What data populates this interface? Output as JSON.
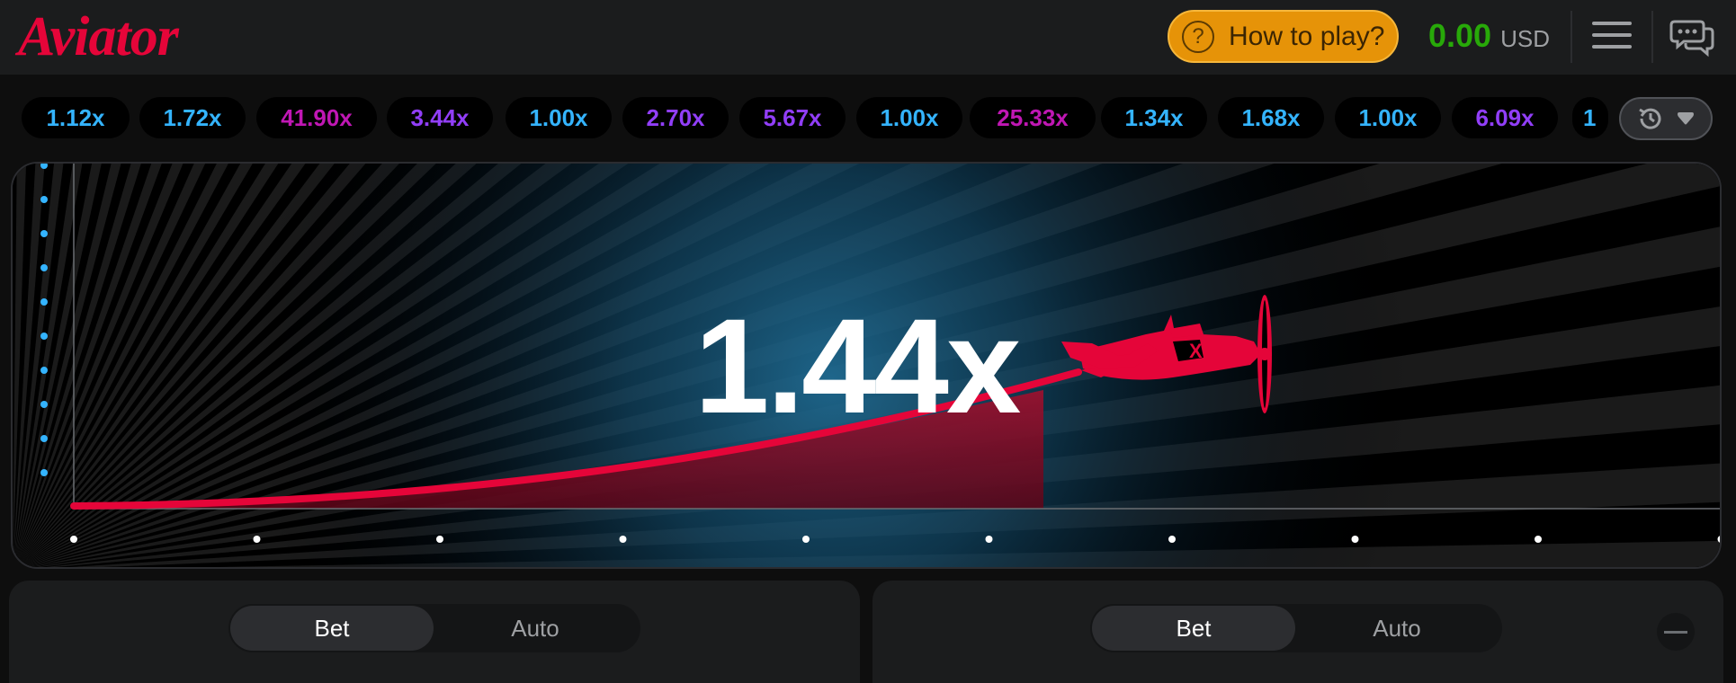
{
  "header": {
    "logo": "Aviator",
    "how_to_play": "How to play?",
    "how_to_play_icon": "question-circle-icon",
    "balance_amount": "0.00",
    "balance_currency": "USD"
  },
  "history": {
    "items": [
      {
        "value": "1.12x",
        "color": "#34b4ff"
      },
      {
        "value": "1.72x",
        "color": "#34b4ff"
      },
      {
        "value": "41.90x",
        "color": "#c017b4"
      },
      {
        "value": "3.44x",
        "color": "#913ef8"
      },
      {
        "value": "1.00x",
        "color": "#34b4ff"
      },
      {
        "value": "2.70x",
        "color": "#913ef8"
      },
      {
        "value": "5.67x",
        "color": "#913ef8"
      },
      {
        "value": "1.00x",
        "color": "#34b4ff"
      },
      {
        "value": "25.33x",
        "color": "#c017b4"
      },
      {
        "value": "1.34x",
        "color": "#34b4ff"
      },
      {
        "value": "1.68x",
        "color": "#34b4ff"
      },
      {
        "value": "1.00x",
        "color": "#34b4ff"
      },
      {
        "value": "6.09x",
        "color": "#913ef8"
      },
      {
        "value": "1",
        "color": "#34b4ff"
      }
    ],
    "toggle_icons": [
      "history-icon",
      "chevron-down-icon"
    ]
  },
  "game": {
    "multiplier": "1.44x",
    "accent": "#e50539"
  },
  "bet_panels": [
    {
      "tabs": [
        "Bet",
        "Auto"
      ],
      "active": "Bet"
    },
    {
      "tabs": [
        "Bet",
        "Auto"
      ],
      "active": "Bet"
    }
  ]
}
